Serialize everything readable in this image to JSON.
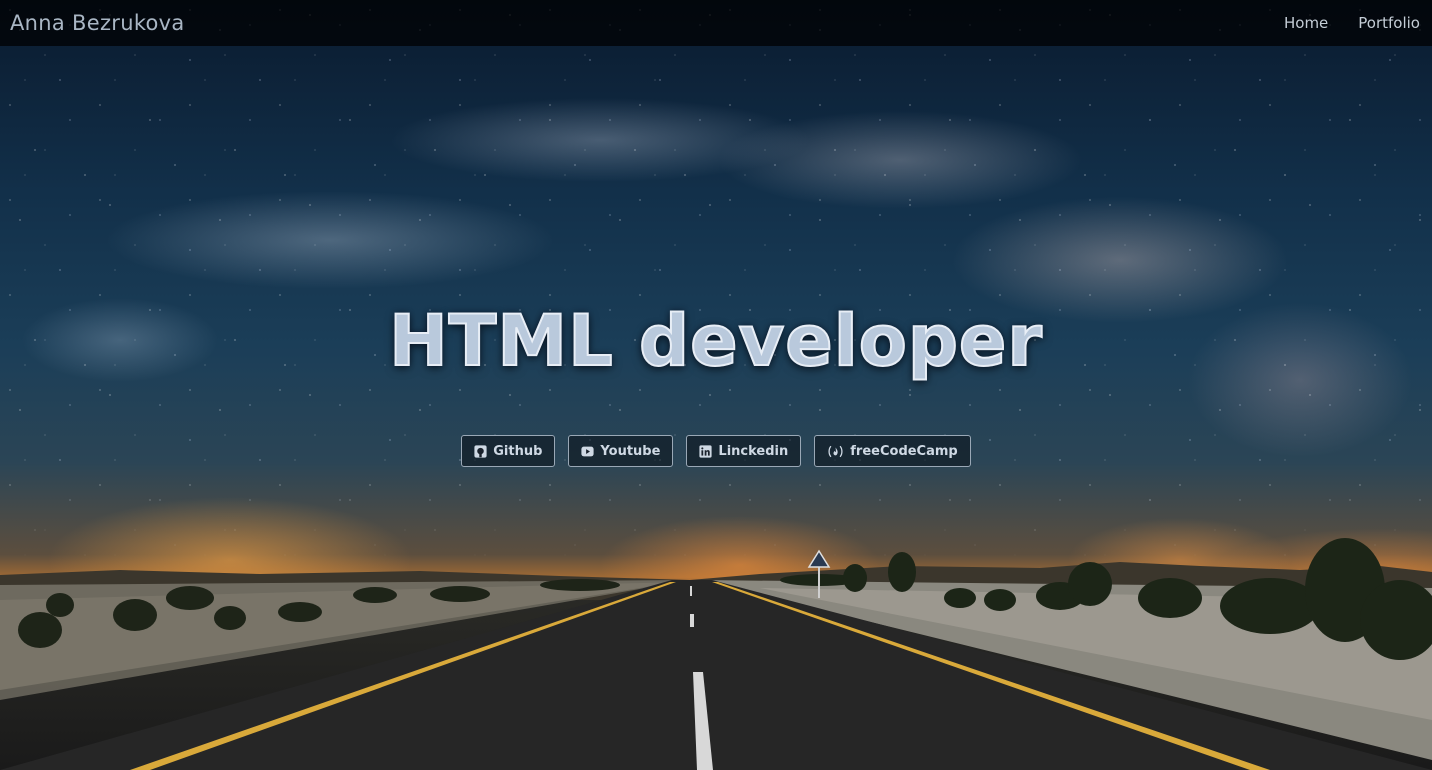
{
  "navbar": {
    "brand": "Anna Bezrukova",
    "links": [
      {
        "label": "Home"
      },
      {
        "label": "Portfolio"
      }
    ]
  },
  "hero": {
    "title": "HTML developer"
  },
  "social": [
    {
      "label": "Github",
      "icon": "github-icon"
    },
    {
      "label": "Youtube",
      "icon": "youtube-icon"
    },
    {
      "label": "Linckedin",
      "icon": "linkedin-icon"
    },
    {
      "label": "freeCodeCamp",
      "icon": "freecodecamp-icon"
    }
  ],
  "colors": {
    "navbar_bg": "#000000",
    "text_light": "#c4cdd6",
    "title_fill": "#b9c9dc"
  }
}
